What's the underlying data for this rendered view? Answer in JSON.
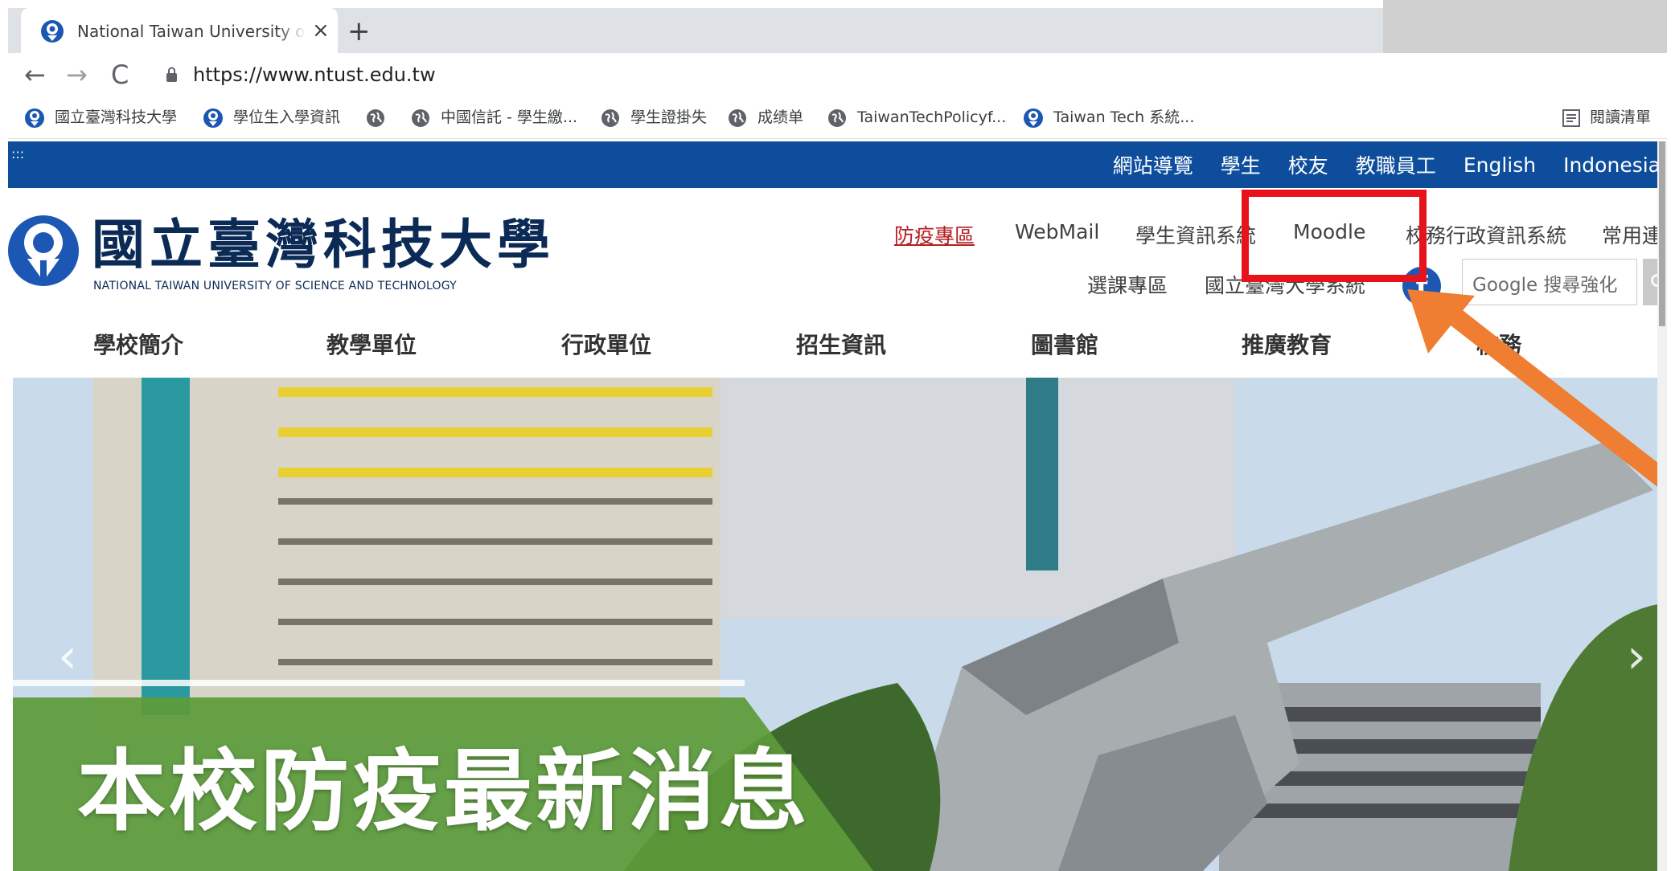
{
  "browser": {
    "tab_title": "National Taiwan University of Science and Technology",
    "tab_close": "×",
    "new_tab": "+",
    "back": "←",
    "forward": "→",
    "reload": "C",
    "url": "https://www.ntust.edu.tw",
    "bookmarks": [
      {
        "label": "國立臺灣科技大學",
        "icon": "ntust-logo-icon"
      },
      {
        "label": "學位生入學資訊",
        "icon": "ntust-logo-icon"
      },
      {
        "label": "",
        "icon": "globe-icon"
      },
      {
        "label": "中國信託 - 學生繳...",
        "icon": "globe-icon"
      },
      {
        "label": "學生證掛失",
        "icon": "globe-icon"
      },
      {
        "label": "成绩单",
        "icon": "globe-icon"
      },
      {
        "label": "TaiwanTechPolicyf...",
        "icon": "globe-icon"
      },
      {
        "label": "Taiwan Tech 系統...",
        "icon": "ntust-logo-icon"
      }
    ],
    "reading_list": "閱讀清單"
  },
  "site": {
    "topbar_dots": ":::",
    "toplinks": [
      "網站導覽",
      "學生",
      "校友",
      "教職員工",
      "English",
      "Indonesia"
    ],
    "logo_cn": "國立臺灣科技大學",
    "logo_en": "NATIONAL TAIWAN UNIVERSITY OF SCIENCE AND TECHNOLOGY",
    "header_links_row1": [
      "防疫專區",
      "WebMail",
      "學生資訊系統",
      "Moodle",
      "校務行政資訊系統",
      "常用連結"
    ],
    "header_links_row2": [
      "選課專區",
      "國立臺灣大學系統"
    ],
    "facebook": "f",
    "search_placeholder": "Google 搜尋強化",
    "search_icon": "search-icon",
    "main_nav": [
      "學校簡介",
      "教學單位",
      "行政單位",
      "招生資訊",
      "圖書館",
      "推廣教育",
      "校務"
    ],
    "hero_headline": "本校防疫最新消息",
    "slide_prev": "‹",
    "slide_next": "›"
  },
  "colors": {
    "topbar": "#0e4d9c",
    "logo_navy": "#0b2a55",
    "covid_link": "#b51e23",
    "annotation_red": "#e8121a",
    "annotation_orange": "#ef7d32",
    "hero_green": "#5e9b3a"
  }
}
